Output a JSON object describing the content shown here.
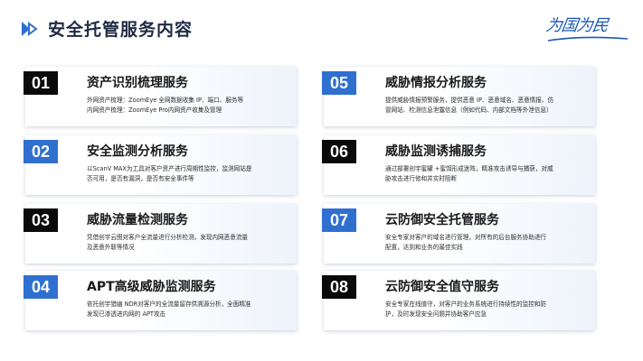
{
  "header": {
    "title": "安全托管服务内容",
    "logo_text": "为国为民"
  },
  "colors": {
    "accent_blue": "#2f6fd0",
    "dark_badge": "#0a0a0a",
    "card_shade": "#eef3fb",
    "logo_blue": "#1b58b5"
  },
  "icons": {
    "title_arrow": "double-play-arrow-icon"
  },
  "services": [
    {
      "number": "01",
      "title": "资产识别梳理服务",
      "desc": [
        "外网资产梳理：ZoomEye 全网数据收集 IP、端口、服务等",
        "内网资产梳理：ZoomEye Pro内网资产收集及管理"
      ]
    },
    {
      "number": "02",
      "title": "安全监测分析服务",
      "desc": [
        "以ScanV MAX为工具对客户资产进行周期性监控，监测网站是",
        "否可用，是否有漏洞，是否有安全事件等"
      ]
    },
    {
      "number": "03",
      "title": "威胁流量检测服务",
      "desc": [
        "凭借创宇云图对客户全流量进行分析检测，发现内网恶意流量",
        "及恶意外联等情况"
      ]
    },
    {
      "number": "04",
      "title": "APT高级威胁监测服务",
      "desc": [
        "依托创宇猎幽 NDR对客户的全流量留存供溯源分析，全面精准",
        "发现已渗透进内网的 APT攻击"
      ]
    },
    {
      "number": "05",
      "title": "威胁情报分析服务",
      "desc": [
        "提供威胁情报预警服务，提供恶意 IP、恶意域名、恶意情报、仿",
        "冒网站、检测信息泄露信息（例如代码、内部文档等外泄信息）"
      ]
    },
    {
      "number": "06",
      "title": "威胁监测诱捕服务",
      "desc": [
        "通过部署创宇蜜罐 +蜜饵形成迷阵，精准攻击诱导与捕获，对威",
        "胁攻击进行修和并实时阻断"
      ]
    },
    {
      "number": "07",
      "title": "云防御安全托管服务",
      "desc": [
        "安全专家对客户的域名进行管理，对所有的后台服务协助进行",
        "配置，达到和业务的最佳实践"
      ]
    },
    {
      "number": "08",
      "title": "云防御安全值守服务",
      "desc": [
        "安全专家在线值守，对客户的业务系统进行持续性的监控和防",
        "护，及时发现安全问题并协助客户应急"
      ]
    }
  ]
}
